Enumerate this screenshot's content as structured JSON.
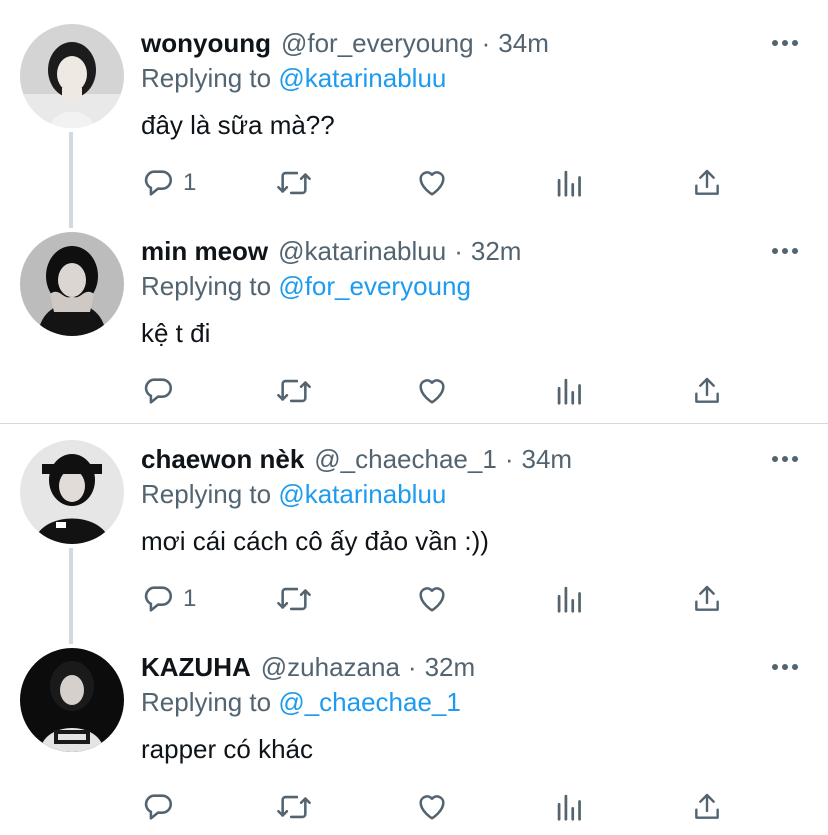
{
  "colors": {
    "link": "#1d9bf0",
    "secondary_text": "#536471",
    "primary_text": "#0f1419",
    "thread_line": "#cfd9de"
  },
  "icons": {
    "reply": "speech-bubble",
    "retweet": "arrows-loop",
    "like": "heart",
    "analytics": "bar-chart",
    "share": "upload-arrow",
    "more": "three-dots"
  },
  "tweets": [
    {
      "name": "wonyoung",
      "handle": "@for_everyoung",
      "separator": "·",
      "time": "34m",
      "reply_prefix": "Replying to",
      "reply_to": "@katarinabluu",
      "text": "đây là sữa mà??",
      "reply_count": "1"
    },
    {
      "name": "min meow",
      "handle": "@katarinabluu",
      "separator": "·",
      "time": "32m",
      "reply_prefix": "Replying to",
      "reply_to": "@for_everyoung",
      "text": "kệ t đi",
      "reply_count": ""
    },
    {
      "name": "chaewon nèk",
      "handle": "@_chaechae_1",
      "separator": "·",
      "time": "34m",
      "reply_prefix": "Replying to",
      "reply_to": "@katarinabluu",
      "text": "mơi cái cách cô ấy đảo vần :))",
      "reply_count": "1"
    },
    {
      "name": "KAZUHA",
      "handle": "@zuhazana",
      "separator": "·",
      "time": "32m",
      "reply_prefix": "Replying to",
      "reply_to": "@_chaechae_1",
      "text": "rapper có khác",
      "reply_count": ""
    }
  ]
}
